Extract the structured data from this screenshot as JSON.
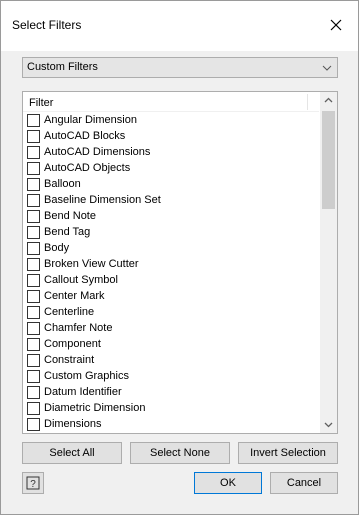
{
  "window": {
    "title": "Select Filters"
  },
  "dropdown": {
    "selected": "Custom Filters"
  },
  "list": {
    "header": "Filter",
    "items": [
      {
        "label": "Angular Dimension",
        "checked": false
      },
      {
        "label": "AutoCAD Blocks",
        "checked": false
      },
      {
        "label": "AutoCAD Dimensions",
        "checked": false
      },
      {
        "label": "AutoCAD Objects",
        "checked": false
      },
      {
        "label": "Balloon",
        "checked": false
      },
      {
        "label": "Baseline Dimension Set",
        "checked": false
      },
      {
        "label": "Bend Note",
        "checked": false
      },
      {
        "label": "Bend Tag",
        "checked": false
      },
      {
        "label": "Body",
        "checked": false
      },
      {
        "label": "Broken View Cutter",
        "checked": false
      },
      {
        "label": "Callout Symbol",
        "checked": false
      },
      {
        "label": "Center Mark",
        "checked": false
      },
      {
        "label": "Centerline",
        "checked": false
      },
      {
        "label": "Chamfer Note",
        "checked": false
      },
      {
        "label": "Component",
        "checked": false
      },
      {
        "label": "Constraint",
        "checked": false
      },
      {
        "label": "Custom Graphics",
        "checked": false
      },
      {
        "label": "Datum Identifier",
        "checked": false
      },
      {
        "label": "Diametric Dimension",
        "checked": false
      },
      {
        "label": "Dimensions",
        "checked": false
      }
    ]
  },
  "buttons": {
    "select_all": "Select All",
    "select_none": "Select None",
    "invert_selection": "Invert Selection",
    "ok": "OK",
    "cancel": "Cancel"
  },
  "colors": {
    "dialog_bg": "#f0f0f0",
    "button_bg": "#e1e1e1",
    "default_button_border": "#0078d7"
  }
}
